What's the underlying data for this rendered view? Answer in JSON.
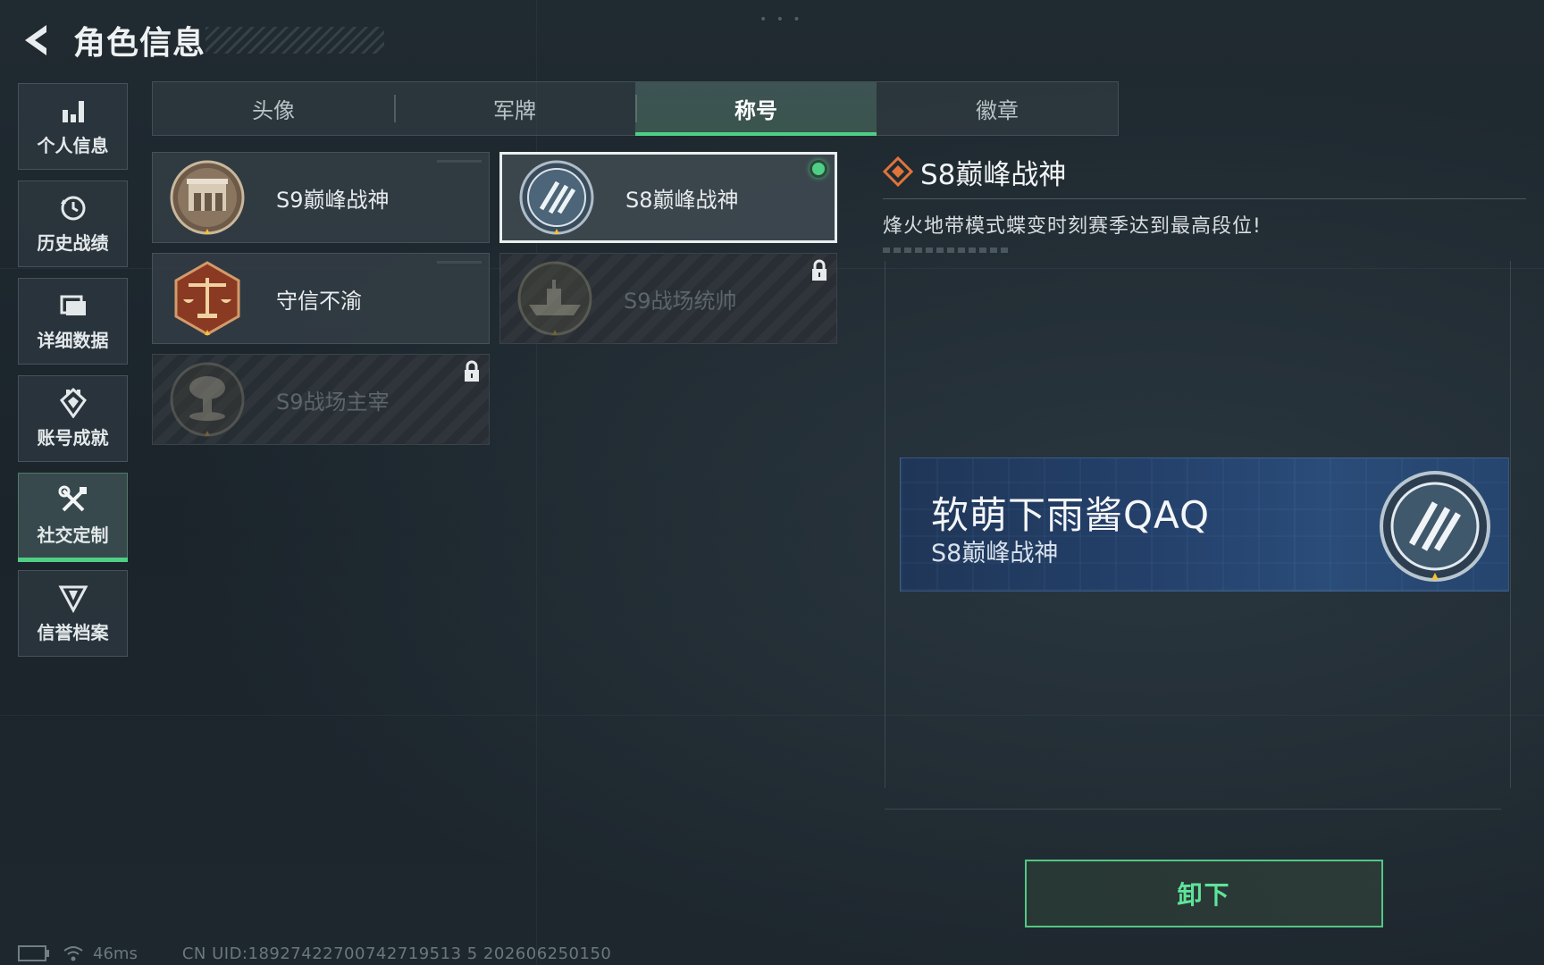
{
  "header": {
    "title": "角色信息"
  },
  "sidebar": {
    "items": [
      {
        "label": "个人信息",
        "icon": "bar-chart-icon"
      },
      {
        "label": "历史战绩",
        "icon": "history-clock-icon"
      },
      {
        "label": "详细数据",
        "icon": "folder-icon"
      },
      {
        "label": "账号成就",
        "icon": "achievement-icon"
      },
      {
        "label": "社交定制",
        "icon": "tools-icon"
      },
      {
        "label": "信誉档案",
        "icon": "credit-shield-icon"
      }
    ],
    "active_index": 4
  },
  "tabs": {
    "items": [
      "头像",
      "军牌",
      "称号",
      "徽章"
    ],
    "active_index": 2
  },
  "titles": [
    {
      "name": "S9巅峰战神",
      "badge": "fortress-badge-icon",
      "state": "owned"
    },
    {
      "name": "S8巅峰战神",
      "badge": "striped-emblem-badge-icon",
      "state": "equipped"
    },
    {
      "name": "守信不渝",
      "badge": "scales-badge-icon",
      "state": "owned"
    },
    {
      "name": "S9战场统帅",
      "badge": "warship-badge-icon",
      "state": "locked"
    },
    {
      "name": "S9战场主宰",
      "badge": "mushroom-cloud-badge-icon",
      "state": "locked"
    }
  ],
  "detail": {
    "title": "S8巅峰战神",
    "description": "烽火地带模式蝶变时刻赛季达到最高段位!"
  },
  "preview": {
    "player_name": "软萌下雨酱QAQ",
    "title": "S8巅峰战神"
  },
  "actions": {
    "unequip_label": "卸下"
  },
  "footer": {
    "ping": "46ms",
    "uid": "CN UID:18927422700742719513 5 202606250150"
  },
  "colors": {
    "accent_green": "#4fcf86",
    "background": "#1c252c",
    "banner_blue": "#24406a",
    "diamond_orange": "#e0743a"
  }
}
